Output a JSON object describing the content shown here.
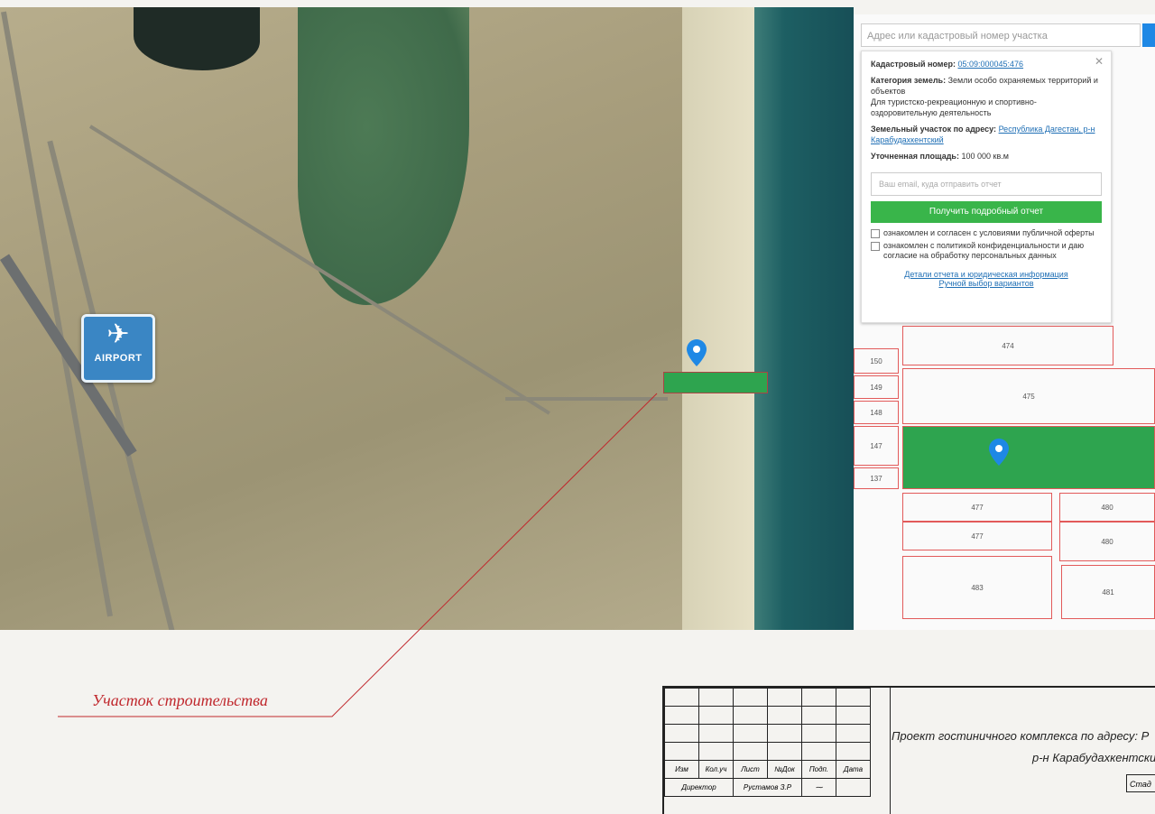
{
  "map": {
    "airport_label": "AIRPORT",
    "airport_icon": "airplane-icon",
    "site_caption": "Участок строительства"
  },
  "cadastre": {
    "search_placeholder": "Адрес или кадастровый номер участка",
    "cadastral_label": "Кадастровый номер:",
    "cadastral_number": "05:09:000045:476",
    "category_label": "Категория земель:",
    "category_value": "Земли особо охраняемых территорий и объектов",
    "category_use": "Для туристско-рекреационную и спортивно-оздоровительную деятельность",
    "address_label": "Земельный участок по адресу:",
    "address_value": "Республика Дагестан, р-н Карабудахкентский",
    "area_label": "Уточненная площадь:",
    "area_value": "100 000 кв.м",
    "email_placeholder": "Ваш email, куда отправить отчет",
    "report_button": "Получить подробный отчет",
    "consent1": "ознакомлен и согласен с условиями публичной оферты",
    "consent2": "ознакомлен с политикой конфиденциальности и даю согласие на обработку персональных данных",
    "link_details": "Детали отчета и юридическая информация",
    "link_manual": "Ручной выбор вариантов",
    "parcels": [
      "474",
      "150",
      "149",
      "475",
      "148",
      "147",
      "137",
      "477",
      "477",
      "480",
      "480",
      "483",
      "481"
    ],
    "accent": "#39b54a"
  },
  "stamp": {
    "headers": [
      "Изм",
      "Кол.уч",
      "Лист",
      "№Док",
      "Подп.",
      "Дата"
    ],
    "role": "Директор",
    "name": "Рустамов З.Р",
    "title_line1": "Проект гостиничного комплекса по адресу: Р",
    "title_line2": "р-н Карабудахкентский",
    "stage": "Стад"
  }
}
